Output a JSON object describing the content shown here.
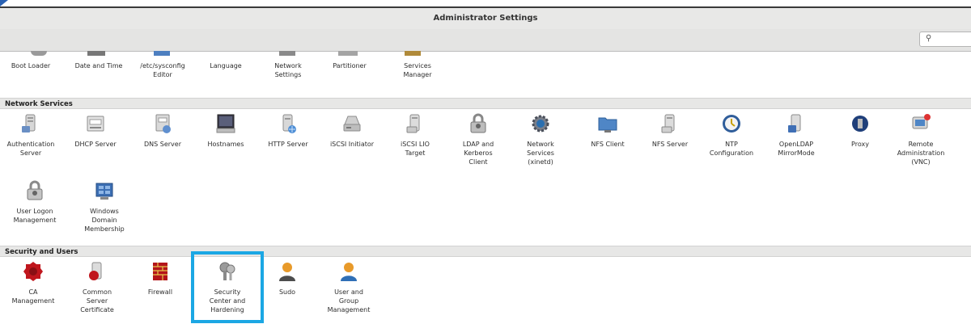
{
  "window": {
    "title": "Administrator Settings"
  },
  "search": {
    "icon": "search-icon"
  },
  "colors": {
    "highlight": "#1ba7e4",
    "section_bg": "#e7e7e6",
    "titlebar_bg": "#e8e8e7"
  },
  "system": {
    "items": [
      {
        "label": "Boot Loader"
      },
      {
        "label": "Date and Time"
      },
      {
        "label": "/etc/sysconfig\nEditor"
      },
      {
        "label": "Language"
      },
      {
        "label": "Network\nSettings"
      },
      {
        "label": "Partitioner"
      },
      {
        "label": "Services\nManager"
      }
    ]
  },
  "network_services": {
    "title": "Network Services",
    "items": [
      {
        "label": "Authentication\nServer",
        "icon": "server-icon"
      },
      {
        "label": "DHCP Server",
        "icon": "dhcp-server-icon"
      },
      {
        "label": "DNS Server",
        "icon": "dns-server-icon"
      },
      {
        "label": "Hostnames",
        "icon": "monitor-icon"
      },
      {
        "label": "HTTP Server",
        "icon": "http-server-icon"
      },
      {
        "label": "iSCSI Initiator",
        "icon": "disk-drive-icon"
      },
      {
        "label": "iSCSI LIO\nTarget",
        "icon": "server-icon"
      },
      {
        "label": "LDAP and\nKerberos\nClient",
        "icon": "lock-user-icon"
      },
      {
        "label": "Network\nServices\n(xinetd)",
        "icon": "gear-network-icon"
      },
      {
        "label": "NFS Client",
        "icon": "folder-network-icon"
      },
      {
        "label": "NFS Server",
        "icon": "server-icon"
      },
      {
        "label": "NTP\nConfiguration",
        "icon": "clock-icon"
      },
      {
        "label": "OpenLDAP\nMirrorMode",
        "icon": "ldap-server-icon"
      },
      {
        "label": "Proxy",
        "icon": "proxy-globe-icon"
      },
      {
        "label": "Remote\nAdministration\n(VNC)",
        "icon": "remote-admin-icon"
      },
      {
        "label": "User Logon\nManagement",
        "icon": "lock-user-icon"
      },
      {
        "label": "Windows\nDomain\nMembership",
        "icon": "windows-domain-icon"
      }
    ]
  },
  "security_users": {
    "title": "Security and Users",
    "items": [
      {
        "label": "CA\nManagement",
        "icon": "ca-seal-icon"
      },
      {
        "label": "Common\nServer\nCertificate",
        "icon": "certificate-server-icon"
      },
      {
        "label": "Firewall",
        "icon": "firewall-icon"
      },
      {
        "label": "Security\nCenter and\nHardening",
        "icon": "security-keys-icon"
      },
      {
        "label": "Sudo",
        "icon": "sudo-user-icon"
      },
      {
        "label": "User and\nGroup\nManagement",
        "icon": "user-group-icon"
      }
    ]
  }
}
